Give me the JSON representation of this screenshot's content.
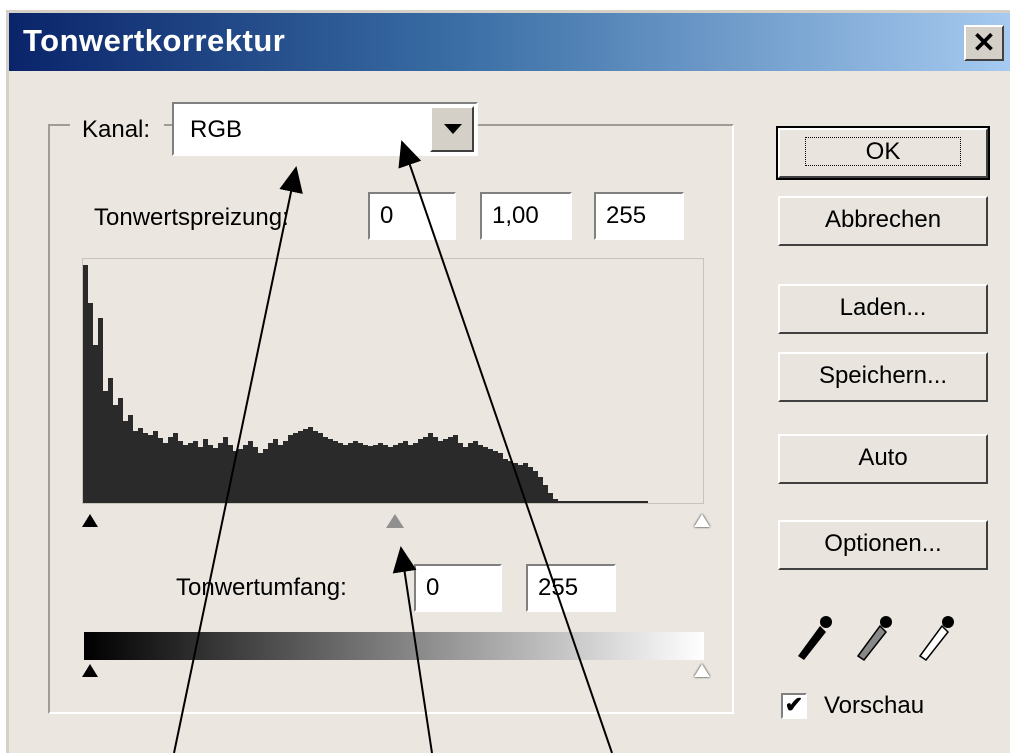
{
  "window": {
    "title": "Tonwertkorrektur",
    "close_label": "✕"
  },
  "channel": {
    "label": "Kanal:",
    "value": "RGB"
  },
  "input_levels": {
    "label": "Tonwertspreizung:",
    "black": "0",
    "gamma": "1,00",
    "white": "255"
  },
  "output_levels": {
    "label": "Tonwertumfang:",
    "black": "0",
    "white": "255"
  },
  "buttons": {
    "ok": "OK",
    "cancel": "Abbrechen",
    "load": "Laden...",
    "save": "Speichern...",
    "auto": "Auto",
    "options": "Optionen..."
  },
  "preview": {
    "label": "Vorschau",
    "checked": true
  },
  "histogram": {
    "bins": [
      238,
      200,
      158,
      185,
      112,
      125,
      98,
      105,
      82,
      88,
      72,
      75,
      70,
      68,
      72,
      65,
      60,
      66,
      70,
      62,
      58,
      60,
      62,
      56,
      64,
      58,
      55,
      60,
      66,
      58,
      52,
      54,
      58,
      62,
      56,
      50,
      54,
      60,
      64,
      58,
      62,
      68,
      70,
      72,
      74,
      76,
      72,
      70,
      66,
      64,
      62,
      60,
      58,
      60,
      62,
      60,
      58,
      57,
      58,
      60,
      58,
      56,
      58,
      60,
      62,
      58,
      60,
      64,
      66,
      70,
      66,
      62,
      64,
      66,
      68,
      60,
      56,
      60,
      62,
      58,
      56,
      54,
      52,
      50,
      44,
      42,
      40,
      38,
      40,
      36,
      32,
      26,
      18,
      10,
      4,
      2,
      2,
      2,
      2,
      2,
      2,
      2,
      2,
      2,
      2,
      2,
      2,
      2,
      2,
      2,
      2,
      2,
      2,
      0,
      0,
      0,
      0,
      0,
      0,
      0,
      0,
      0,
      0,
      0
    ]
  },
  "colors": {
    "accent": "#0a246a",
    "histogram_fill": "#2a2a2a",
    "dialog_bg": "#ebe6df"
  }
}
